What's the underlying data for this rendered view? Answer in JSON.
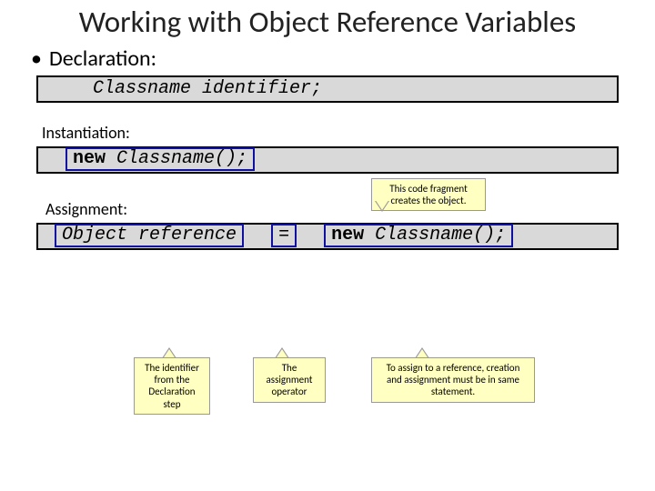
{
  "title": "Working with Object Reference Variables",
  "sections": {
    "declaration": {
      "label": "Declaration:",
      "code": "Classname identifier;"
    },
    "instantiation": {
      "label": "Instantiation:",
      "kw": "new",
      "call": " Classname();"
    },
    "assignment": {
      "label": "Assignment:",
      "ref": "Object reference",
      "eq": "=",
      "kw": "new",
      "call": " Classname();"
    }
  },
  "callouts": {
    "creates": "This code fragment creates the object.",
    "identifier": "The identifier from the Declaration step",
    "operator": "The assignment operator",
    "same_stmt": "To assign to a reference, creation and assignment must be in same statement."
  }
}
